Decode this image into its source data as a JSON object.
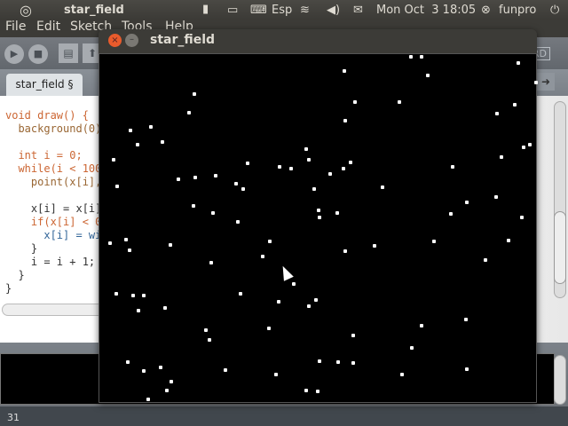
{
  "topbar": {
    "app_title": "star_field",
    "keyboard_layout": "Esp",
    "datetime": "Mon Oct  3 18:05",
    "user": "funpro"
  },
  "menu": [
    "File",
    "Edit",
    "Sketch",
    "Tools",
    "Help"
  ],
  "toolbar": {
    "mode_label": "STANDARD"
  },
  "tabs": [
    {
      "label": "star_field §"
    }
  ],
  "code": {
    "lines": [
      "void draw() {",
      "  background(0)",
      "",
      "  int i = 0;",
      "  while(i < 100",
      "    point(x[i],",
      "",
      "    x[i] = x[i]",
      "    if(x[i] < 0",
      "      x[i] = wi",
      "    }",
      "    i = i + 1;",
      "  }",
      "}"
    ]
  },
  "status": {
    "line_number": "31"
  },
  "sketch_window": {
    "title": "star_field"
  }
}
